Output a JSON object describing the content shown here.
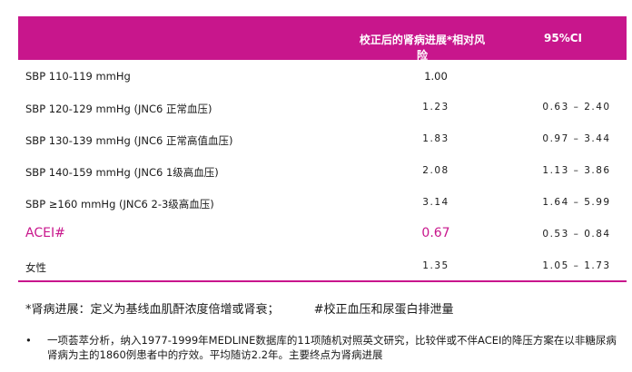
{
  "table": {
    "header": {
      "col1": "",
      "col2": "校正后的肾病进展*相对风险",
      "col3": "95%CI"
    },
    "rows": [
      {
        "label": "SBP  110-119 mmHg",
        "value": "1.00",
        "ci": ""
      },
      {
        "label": "SBP  120-129 mmHg (JNC6 正常血压)",
        "value": "1.23",
        "ci": "0.63 – 2.40"
      },
      {
        "label": "SBP  130-139 mmHg (JNC6 正常高值血压)",
        "value": "1.83",
        "ci": "0.97 – 3.44"
      },
      {
        "label": "SBP  140-159 mmHg (JNC6 1级高血压)",
        "value": "2.08",
        "ci": "1.13 – 3.86"
      },
      {
        "label": "SBP  ≥160 mmHg (JNC6 2-3级高血压)",
        "value": "3.14",
        "ci": "1.64 – 5.99"
      },
      {
        "label": "ACEI#",
        "value": "0.67",
        "ci": "0.53 – 0.84"
      },
      {
        "label": "女性",
        "value": "1.35",
        "ci": "1.05 – 1.73"
      }
    ]
  },
  "footnotes": {
    "note1": "*肾病进展：定义为基线血肌酐浓度倍增或肾衰；",
    "note2": "#校正血压和尿蛋白排泄量"
  },
  "bullet": {
    "dot": "•",
    "text": "一项荟萃分析，纳入1977-1999年MEDLINE数据库的11项随机对照英文研究，比较伴或不伴ACEI的降压方案在以非糖尿病肾病为主的1860例患者中的疗效。平均随访2.2年。主要终点为肾病进展"
  },
  "colors": {
    "accent": "#c8168c"
  }
}
